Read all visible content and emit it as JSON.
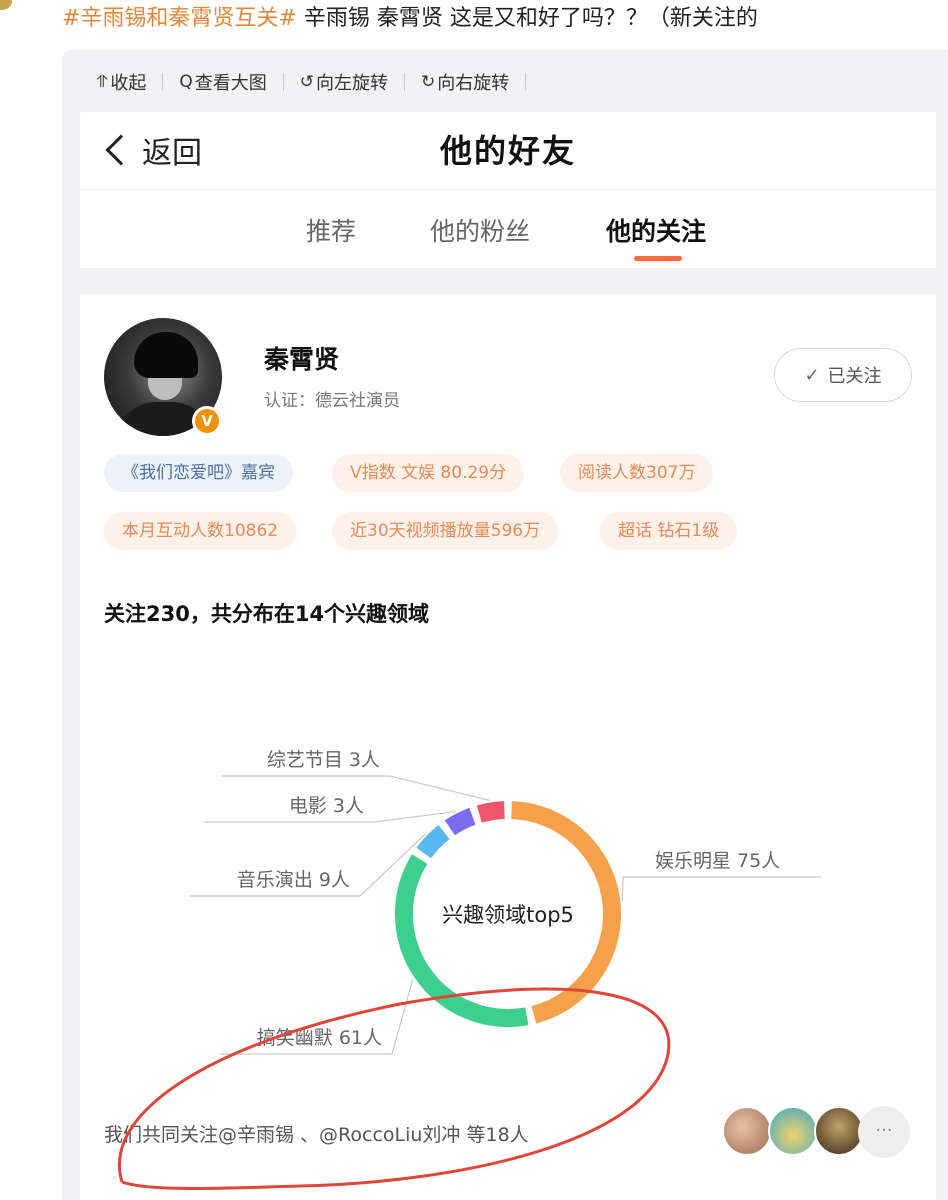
{
  "post": {
    "hashtag": "#辛雨锡和秦霄贤互关#",
    "text": " 辛雨锡 秦霄贤 这是又和好了吗？？（新关注的"
  },
  "toolbar": {
    "collapse": "收起",
    "view_large": "查看大图",
    "rotate_left": "向左旋转",
    "rotate_right": "向右旋转"
  },
  "nav": {
    "back": "返回",
    "title": "他的好友"
  },
  "tabs": [
    {
      "label": "推荐"
    },
    {
      "label": "他的粉丝"
    },
    {
      "label": "他的关注"
    }
  ],
  "user": {
    "name": "秦霄贤",
    "verify": "认证：德云社演员",
    "badge": "V",
    "follow_label": "已关注"
  },
  "tags": [
    {
      "label": "《我们恋爱吧》嘉宾"
    },
    {
      "label": "V指数 文娱 80.29分"
    },
    {
      "label": "阅读人数307万"
    },
    {
      "label": "本月互动人数10862"
    },
    {
      "label": "近30天视频播放量596万"
    },
    {
      "label": "超话 钻石1级"
    }
  ],
  "summary": "关注230，共分布在14个兴趣领域",
  "chart_data": {
    "type": "pie",
    "title": "兴趣领域top5",
    "series": [
      {
        "name": "娱乐明星",
        "value": 75,
        "label": "娱乐明星 75人",
        "color": "#f5a04a"
      },
      {
        "name": "搞笑幽默",
        "value": 61,
        "label": "搞笑幽默 61人",
        "color": "#3ccf8e"
      },
      {
        "name": "音乐演出",
        "value": 9,
        "label": "音乐演出 9人",
        "color": "#5ab8f0"
      },
      {
        "name": "电影",
        "value": 3,
        "label": "电影 3人",
        "color": "#7b6cf0"
      },
      {
        "name": "综艺节目",
        "value": 3,
        "label": "综艺节目 3人",
        "color": "#f0566a"
      }
    ]
  },
  "mutual": {
    "text": "我们共同关注@辛雨锡 、@RoccoLiu刘冲 等18人",
    "more": "···"
  },
  "colors": {
    "accent": "#ff6a3d",
    "annotation": "#e0453a"
  }
}
